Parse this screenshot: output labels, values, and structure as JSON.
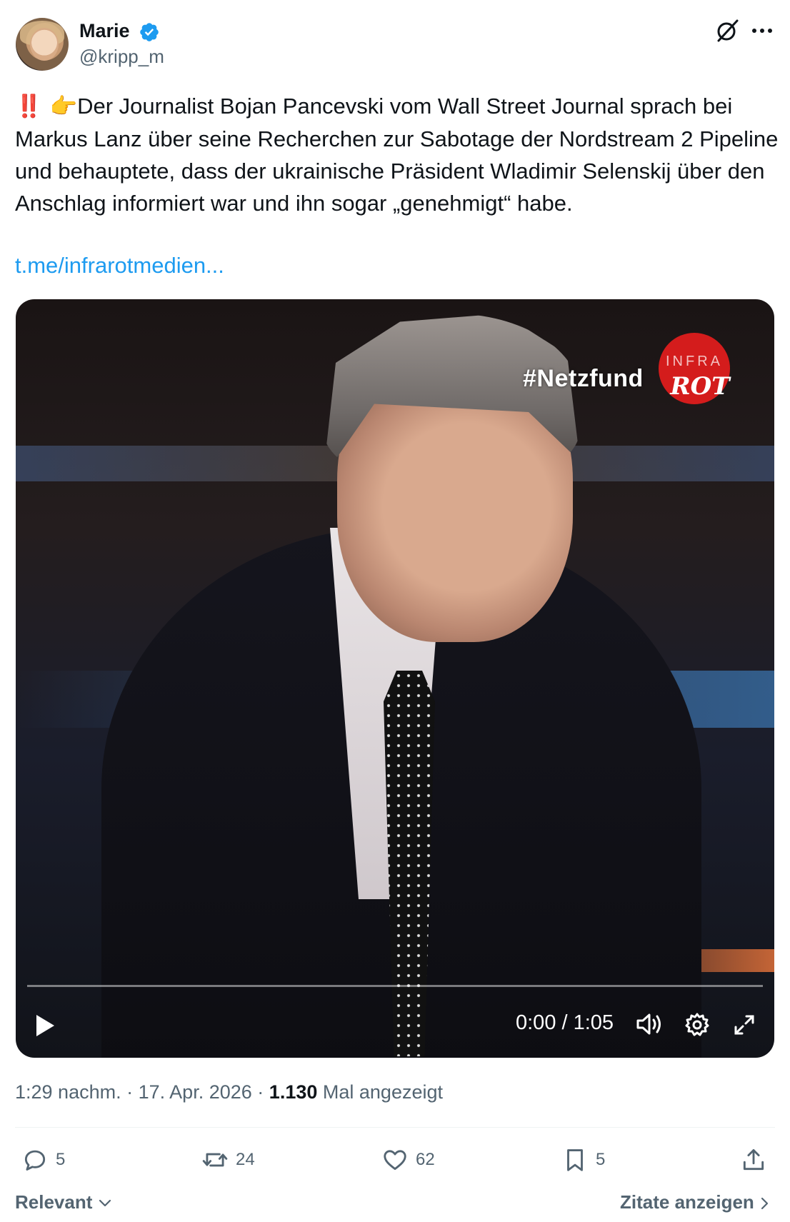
{
  "author": {
    "name": "Marie",
    "handle": "@kripp_m",
    "verified_icon": "verified-badge-icon",
    "brand_color": "#1d9bf0"
  },
  "tweet": {
    "emoji": "‼️ 👉",
    "text": "Der Journalist Bojan Pancevski vom Wall Street Journal sprach bei Markus Lanz über seine Recherchen zur Sabotage der Nordstream 2 Pipeline und behauptete, dass der ukrainische Präsident Wladimir Selenskij über den Anschlag informiert war und ihn sogar „genehmigt“ habe.",
    "link": "t.me/infrarotmedien..."
  },
  "video": {
    "overlay_text": "#Netzfund",
    "logo_text_top": "INFRA",
    "logo_text_bottom": "ROT",
    "time": "0:00 / 1:05",
    "progress": 0
  },
  "meta": {
    "time": "1:29 nachm.",
    "separator": "·",
    "date": "17. Apr. 2026",
    "views_count": "1.130",
    "views_label": "Mal angezeigt"
  },
  "actions": {
    "replies": "5",
    "reposts": "24",
    "likes": "62",
    "bookmarks": "5"
  },
  "footer": {
    "sort_label": "Relevant",
    "quotes_label": "Zitate anzeigen"
  }
}
